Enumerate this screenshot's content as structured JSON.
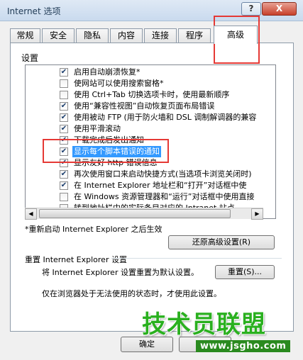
{
  "window": {
    "title": "Internet 选项",
    "help_label": "?",
    "close_label": "X"
  },
  "tabs": [
    {
      "label": "常规"
    },
    {
      "label": "安全"
    },
    {
      "label": "隐私"
    },
    {
      "label": "内容"
    },
    {
      "label": "连接"
    },
    {
      "label": "程序"
    },
    {
      "label": "高级"
    }
  ],
  "settings": {
    "group_label": "设置",
    "items": [
      {
        "label": "启用自动崩溃恢复*",
        "checked": true
      },
      {
        "label": "使网站可以使用搜索窗格*",
        "checked": false
      },
      {
        "label": "使用 Ctrl+Tab 切换选项卡时，使用最新顺序",
        "checked": false
      },
      {
        "label": "使用“兼容性视图”自动恢复页面布局错误",
        "checked": true
      },
      {
        "label": "使用被动 FTP (用于防火墙和 DSL 调制解调器的兼容",
        "checked": true
      },
      {
        "label": "使用平滑滚动",
        "checked": true
      },
      {
        "label": "下载完成后发出通知",
        "checked": true
      },
      {
        "label": "显示每个脚本错误的通知",
        "checked": true,
        "selected": true
      },
      {
        "label": "显示友好 http 错误信息",
        "checked": true
      },
      {
        "label": "再次使用窗口来启动快捷方式(当选项卡浏览关闭时)",
        "checked": true
      },
      {
        "label": "在 Internet Explorer 地址栏和“打开”对话框中使",
        "checked": true
      },
      {
        "label": "在 Windows 资源管理器和“运行”对话框中使用直接",
        "checked": false
      },
      {
        "label": "转到地址栏中的实际条目对应的 Intranet 站点",
        "checked": false
      }
    ],
    "restart_note": "*重新启动 Internet Explorer 之后生效",
    "restore_button": "还原高级设置(R)"
  },
  "reset": {
    "title": "重置 Internet Explorer 设置",
    "description": "将 Internet Explorer 设置重置为默认设置。",
    "button": "重置(S)...",
    "warning": "仅在浏览器处于无法使用的状态时，才使用此设置。"
  },
  "footer": {
    "ok_label": "确定",
    "cancel_label": "取消"
  },
  "watermark": {
    "text": "技术员联盟",
    "url": "www.jsgho.com"
  },
  "colors": {
    "selection": "#3399ff",
    "annotation": "#e53935",
    "watermark": "#2ab01f"
  }
}
